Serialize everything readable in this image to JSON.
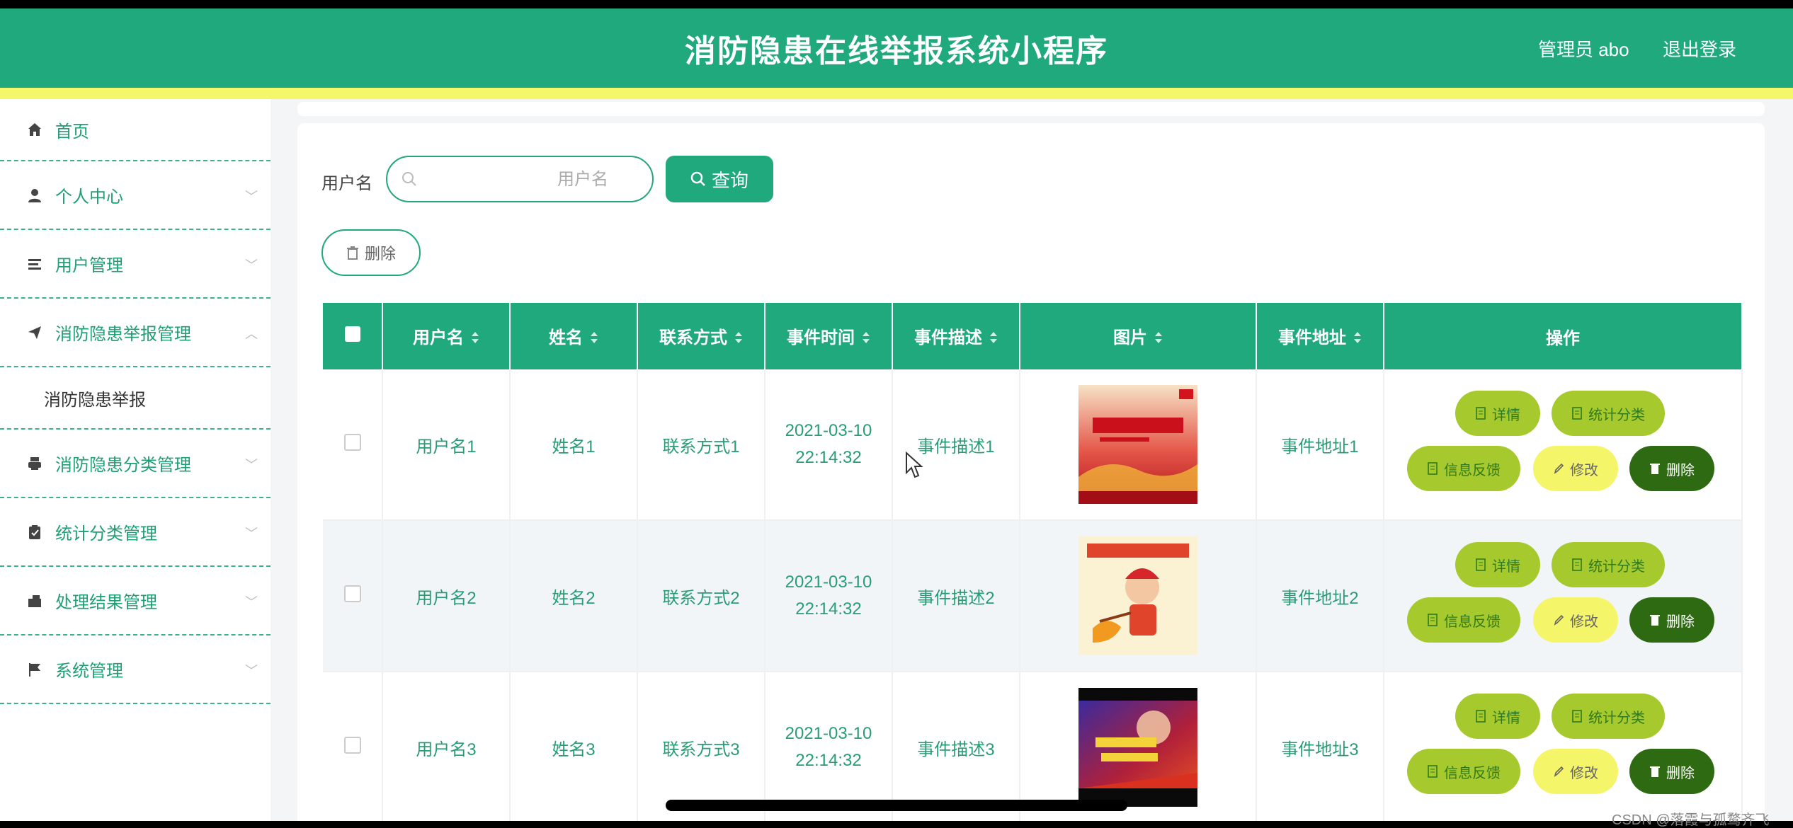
{
  "header": {
    "title": "消防隐患在线举报系统小程序",
    "admin_label": "管理员 abo",
    "logout_label": "退出登录"
  },
  "sidebar": {
    "items": [
      {
        "label": "首页",
        "icon": "home-icon"
      },
      {
        "label": "个人中心",
        "icon": "user-icon"
      },
      {
        "label": "用户管理",
        "icon": "list-icon"
      },
      {
        "label": "消防隐患举报管理",
        "icon": "send-icon",
        "expanded": true
      },
      {
        "label": "消防隐患分类管理",
        "icon": "printer-icon"
      },
      {
        "label": "统计分类管理",
        "icon": "clipboard-icon"
      },
      {
        "label": "处理结果管理",
        "icon": "briefcase-icon"
      },
      {
        "label": "系统管理",
        "icon": "flag-icon"
      }
    ],
    "subitems": [
      {
        "label": "消防隐患举报"
      }
    ]
  },
  "search": {
    "label": "用户名",
    "placeholder": "用户名",
    "value": "",
    "button_label": "查询"
  },
  "toolbar": {
    "delete_label": "删除"
  },
  "table": {
    "columns": [
      "用户名",
      "姓名",
      "联系方式",
      "事件时间",
      "事件描述",
      "图片",
      "事件地址",
      "操作"
    ],
    "rows": [
      {
        "username": "用户名1",
        "name": "姓名1",
        "contact": "联系方式1",
        "date": "2021-03-10",
        "time": "22:14:32",
        "description": "事件描述1",
        "image": "fire-safety-poster-1",
        "address": "事件地址1"
      },
      {
        "username": "用户名2",
        "name": "姓名2",
        "contact": "联系方式2",
        "date": "2021-03-10",
        "time": "22:14:32",
        "description": "事件描述2",
        "image": "fire-safety-poster-2",
        "address": "事件地址2"
      },
      {
        "username": "用户名3",
        "name": "姓名3",
        "contact": "联系方式3",
        "date": "2021-03-10",
        "time": "22:14:32",
        "description": "事件描述3",
        "image": "fire-safety-poster-3",
        "address": "事件地址3"
      }
    ],
    "actions": {
      "detail": "详情",
      "stats": "统计分类",
      "feedback": "信息反馈",
      "edit": "修改",
      "remove": "删除"
    }
  },
  "watermark": "CSDN @落霞与孤鹜齐飞",
  "colors": {
    "primary": "#20a97d",
    "stripe": "#f5f76a",
    "action_green": "#a6c92d",
    "action_yellow": "#f5f56a",
    "action_dark": "#2e6a12"
  }
}
